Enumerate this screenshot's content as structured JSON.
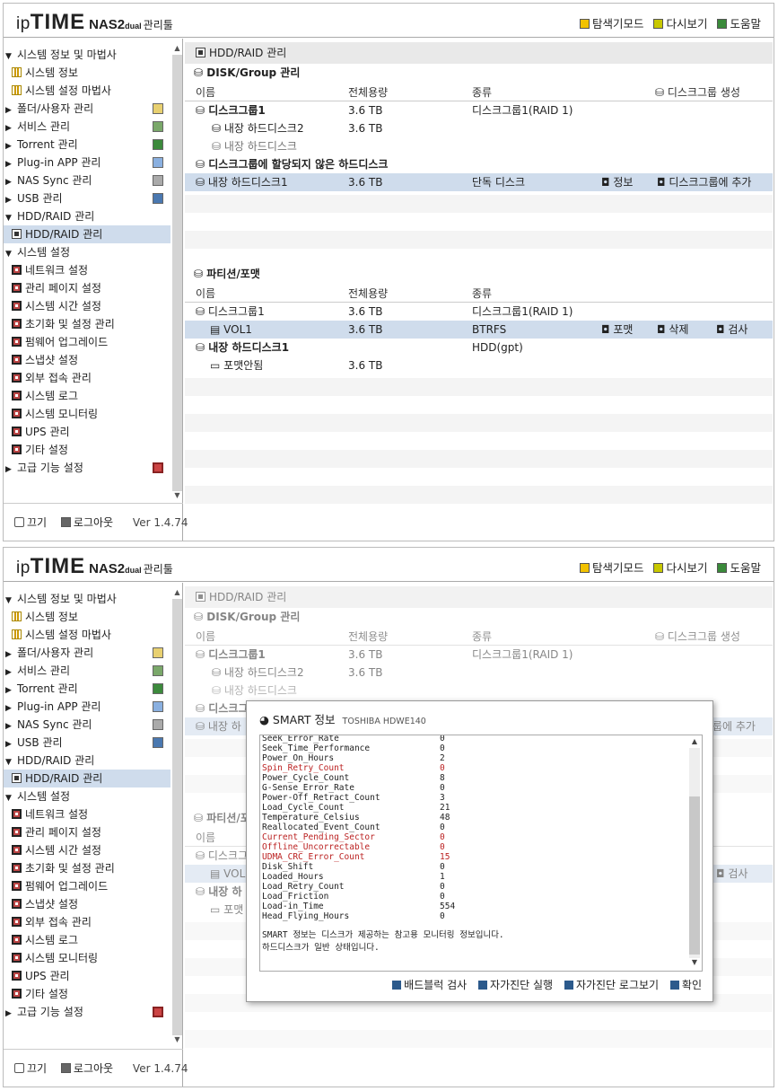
{
  "header": {
    "logo_ip": "ip",
    "logo_time": "TIME",
    "logo_nas": "NAS2",
    "logo_dual": "dual",
    "logo_tool": "관리툴",
    "explorer_mode": "탐색기모드",
    "refresh": "다시보기",
    "help": "도움말"
  },
  "sidebar": {
    "sysinfo_group": "시스템 정보 및 마법사",
    "sysinfo": "시스템 정보",
    "wizard": "시스템 설정 마법사",
    "folder_user": "폴더/사용자 관리",
    "service": "서비스 관리",
    "torrent": "Torrent 관리",
    "plugin": "Plug-in APP 관리",
    "nassync": "NAS Sync 관리",
    "usb": "USB 관리",
    "hddraid_group": "HDD/RAID 관리",
    "hddraid": "HDD/RAID 관리",
    "syssettings_group": "시스템 설정",
    "network": "네트워크 설정",
    "adminpage": "관리 페이지 설정",
    "systime": "시스템 시간 설정",
    "reset": "초기화 및 설정 관리",
    "firmware": "펌웨어 업그레이드",
    "snapshot": "스냅샷 설정",
    "external": "외부 접속 관리",
    "syslog": "시스템 로그",
    "monitoring": "시스템 모니터링",
    "ups": "UPS 관리",
    "other": "기타 설정",
    "advanced": "고급 기능 설정"
  },
  "footer": {
    "power": "끄기",
    "logout": "로그아웃",
    "version": "Ver 1.4.74"
  },
  "main": {
    "page_title": "HDD/RAID 관리",
    "disk_section": "DISK/Group 관리",
    "col_name": "이름",
    "col_capacity": "전체용량",
    "col_type": "종류",
    "create_group": "디스크그룹 생성",
    "group1_name": "디스크그룹1",
    "group1_cap": "3.6 TB",
    "group1_type": "디스크그룹1(RAID 1)",
    "int_disk2": "내장 하드디스크2",
    "int_disk2_cap": "3.6 TB",
    "int_disk": "내장 하드디스크",
    "unassigned": "디스크그룹에 할당되지 않은 하드디스크",
    "int_disk1": "내장 하드디스크1",
    "int_disk1_cap": "3.6 TB",
    "int_disk1_type": "단독 디스크",
    "info_btn": "정보",
    "add_to_group": "디스크그룹에 추가",
    "partition_section": "파티션/포맷",
    "p_group1": "디스크그룹1",
    "p_group1_cap": "3.6 TB",
    "p_group1_type": "디스크그룹1(RAID 1)",
    "vol1": "VOL1",
    "vol1_cap": "3.6 TB",
    "vol1_type": "BTRFS",
    "format_btn": "포맷",
    "delete_btn": "삭제",
    "check_btn": "검사",
    "p_disk1": "내장 하드디스크1",
    "p_disk1_type": "HDD(gpt)",
    "unformatted": "포맷안됨",
    "unformatted_cap": "3.6 TB"
  },
  "main2": {
    "group_trunc": "디스크그",
    "disk1_trunc": "내장 하",
    "add_trunc": "룹에 추가",
    "partition_trunc": "파티션/포",
    "p_group_trunc": "디스크그",
    "vol_trunc": "VOL",
    "check_btn": "검사",
    "p_disk_trunc": "내장 하",
    "unformatted_trunc": "포맷"
  },
  "modal": {
    "title": "SMART 정보",
    "model": "TOSHIBA HDWE140",
    "rows": [
      {
        "k": "Seek_Error_Rate",
        "v": "0",
        "warn": false
      },
      {
        "k": "Seek_Time_Performance",
        "v": "0",
        "warn": false
      },
      {
        "k": "Power_On_Hours",
        "v": "2",
        "warn": false
      },
      {
        "k": "Spin_Retry_Count",
        "v": "0",
        "warn": true
      },
      {
        "k": "Power_Cycle_Count",
        "v": "8",
        "warn": false
      },
      {
        "k": "G-Sense_Error_Rate",
        "v": "0",
        "warn": false
      },
      {
        "k": "Power-Off_Retract_Count",
        "v": "3",
        "warn": false
      },
      {
        "k": "Load_Cycle_Count",
        "v": "21",
        "warn": false
      },
      {
        "k": "Temperature_Celsius",
        "v": "48",
        "warn": false
      },
      {
        "k": "Reallocated_Event_Count",
        "v": "0",
        "warn": false
      },
      {
        "k": "Current_Pending_Sector",
        "v": "0",
        "warn": true
      },
      {
        "k": "Offline_Uncorrectable",
        "v": "0",
        "warn": true
      },
      {
        "k": "UDMA_CRC_Error_Count",
        "v": "15",
        "warn": true
      },
      {
        "k": "Disk_Shift",
        "v": "0",
        "warn": false
      },
      {
        "k": "Loaded_Hours",
        "v": "1",
        "warn": false
      },
      {
        "k": "Load_Retry_Count",
        "v": "0",
        "warn": false
      },
      {
        "k": "Load_Friction",
        "v": "0",
        "warn": false
      },
      {
        "k": "Load-in_Time",
        "v": "554",
        "warn": false
      },
      {
        "k": "Head_Flying_Hours",
        "v": "0",
        "warn": false
      }
    ],
    "note1": "SMART 정보는 디스크가 제공하는 참고용 모니터링 정보입니다.",
    "note2": "하드디스크가 일반 상태입니다.",
    "btn_badblock": "배드블럭 검사",
    "btn_selftest": "자가진단 실행",
    "btn_selftest_log": "자가진단 로그보기",
    "btn_ok": "확인"
  },
  "colors": {
    "selected_row": "#cfdcec",
    "warn_text": "#bb2222",
    "header_title_bg": "#e9e9e9"
  }
}
